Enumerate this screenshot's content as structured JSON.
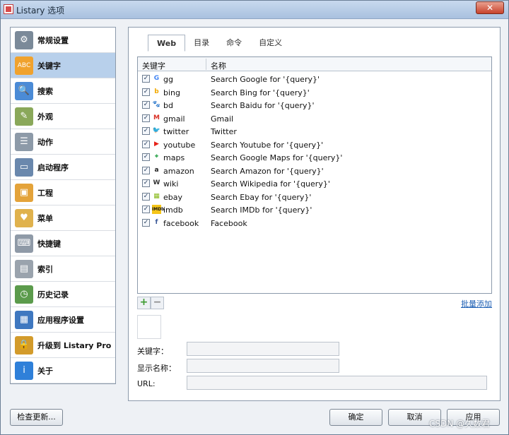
{
  "window": {
    "title": "Listary 选项",
    "close_symbol": "✕"
  },
  "sidebar": {
    "items": [
      {
        "label": "常规设置",
        "icon": "gear-icon",
        "glyph": "⚙",
        "color": "#7b8a99",
        "selected": false
      },
      {
        "label": "关键字",
        "icon": "abc-icon",
        "glyph": "ABC",
        "color": "#f0a22e",
        "selected": true
      },
      {
        "label": "搜索",
        "icon": "magnifier-icon",
        "glyph": "🔍",
        "color": "#4b8bd6",
        "selected": false
      },
      {
        "label": "外观",
        "icon": "palette-icon",
        "glyph": "✎",
        "color": "#8aa85a",
        "selected": false
      },
      {
        "label": "动作",
        "icon": "action-list-icon",
        "glyph": "☰",
        "color": "#8d9aa8",
        "selected": false
      },
      {
        "label": "启动程序",
        "icon": "launcher-window-icon",
        "glyph": "▭",
        "color": "#6a88ad",
        "selected": false
      },
      {
        "label": "工程",
        "icon": "project-cube-icon",
        "glyph": "▣",
        "color": "#e4a33a",
        "selected": false
      },
      {
        "label": "菜单",
        "icon": "folder-heart-icon",
        "glyph": "♥",
        "color": "#e0b24d",
        "selected": false
      },
      {
        "label": "快捷键",
        "icon": "keyboard-icon",
        "glyph": "⌨",
        "color": "#8f9aa7",
        "selected": false
      },
      {
        "label": "索引",
        "icon": "index-drive-icon",
        "glyph": "▤",
        "color": "#9aa3ad",
        "selected": false
      },
      {
        "label": "历史记录",
        "icon": "clock-icon",
        "glyph": "◷",
        "color": "#5b9b4c",
        "selected": false
      },
      {
        "label": "应用程序设置",
        "icon": "app-settings-icon",
        "glyph": "▦",
        "color": "#3f78c0",
        "selected": false
      },
      {
        "label": "升级到 Listary Pro",
        "icon": "upgrade-lock-icon",
        "glyph": "🔒",
        "color": "#d39b2b",
        "selected": false
      },
      {
        "label": "关于",
        "icon": "info-icon",
        "glyph": "i",
        "color": "#2f80d9",
        "selected": false
      }
    ]
  },
  "tabs": [
    {
      "label": "Web",
      "active": true
    },
    {
      "label": "目录",
      "active": false
    },
    {
      "label": "命令",
      "active": false
    },
    {
      "label": "自定义",
      "active": false
    }
  ],
  "table": {
    "headers": {
      "key": "关键字",
      "name": "名称"
    },
    "rows": [
      {
        "checked": true,
        "key": "gg",
        "name": "Search Google for '{query}'",
        "icon": "google-icon",
        "glyph": "G",
        "color": "#4285f4"
      },
      {
        "checked": true,
        "key": "bing",
        "name": "Search Bing for '{query}'",
        "icon": "bing-icon",
        "glyph": "b",
        "color": "#f2a900"
      },
      {
        "checked": true,
        "key": "bd",
        "name": "Search Baidu for '{query}'",
        "icon": "baidu-paw-icon",
        "glyph": "🐾",
        "color": "#2f57d2"
      },
      {
        "checked": true,
        "key": "gmail",
        "name": "Gmail",
        "icon": "gmail-icon",
        "glyph": "M",
        "color": "#d93025"
      },
      {
        "checked": true,
        "key": "twitter",
        "name": "Twitter",
        "icon": "twitter-bird-icon",
        "glyph": "🐦",
        "color": "#1da1f2"
      },
      {
        "checked": true,
        "key": "youtube",
        "name": "Search Youtube for '{query}'",
        "icon": "youtube-icon",
        "glyph": "▶",
        "color": "#e62117"
      },
      {
        "checked": true,
        "key": "maps",
        "name": "Search Google Maps for '{query}'",
        "icon": "maps-pin-icon",
        "glyph": "⌖",
        "color": "#34a853"
      },
      {
        "checked": true,
        "key": "amazon",
        "name": "Search Amazon for '{query}'",
        "icon": "amazon-icon",
        "glyph": "a",
        "color": "#222222"
      },
      {
        "checked": true,
        "key": "wiki",
        "name": "Search Wikipedia for '{query}'",
        "icon": "wikipedia-icon",
        "glyph": "W",
        "color": "#333333"
      },
      {
        "checked": true,
        "key": "ebay",
        "name": "Search Ebay for '{query}'",
        "icon": "ebay-bag-icon",
        "glyph": "▦",
        "color": "#86b817"
      },
      {
        "checked": true,
        "key": "imdb",
        "name": "Search IMDb for '{query}'",
        "icon": "imdb-icon",
        "glyph": "IMDb",
        "color": "#f5c518"
      },
      {
        "checked": true,
        "key": "facebook",
        "name": "Facebook",
        "icon": "facebook-icon",
        "glyph": "f",
        "color": "#3b5998"
      }
    ]
  },
  "controls": {
    "add_symbol": "+",
    "remove_symbol": "−",
    "bulk_add_link": "批量添加"
  },
  "form": {
    "keyword_label": "关键字：",
    "keyword_value": "",
    "display_name_label": "显示名称：",
    "display_name_value": "",
    "url_label": "URL:",
    "url_value": ""
  },
  "buttons": {
    "check_updates": "检查更新...",
    "ok": "确定",
    "cancel": "取消",
    "apply": "应用"
  },
  "watermark": "CSDN @久数君"
}
